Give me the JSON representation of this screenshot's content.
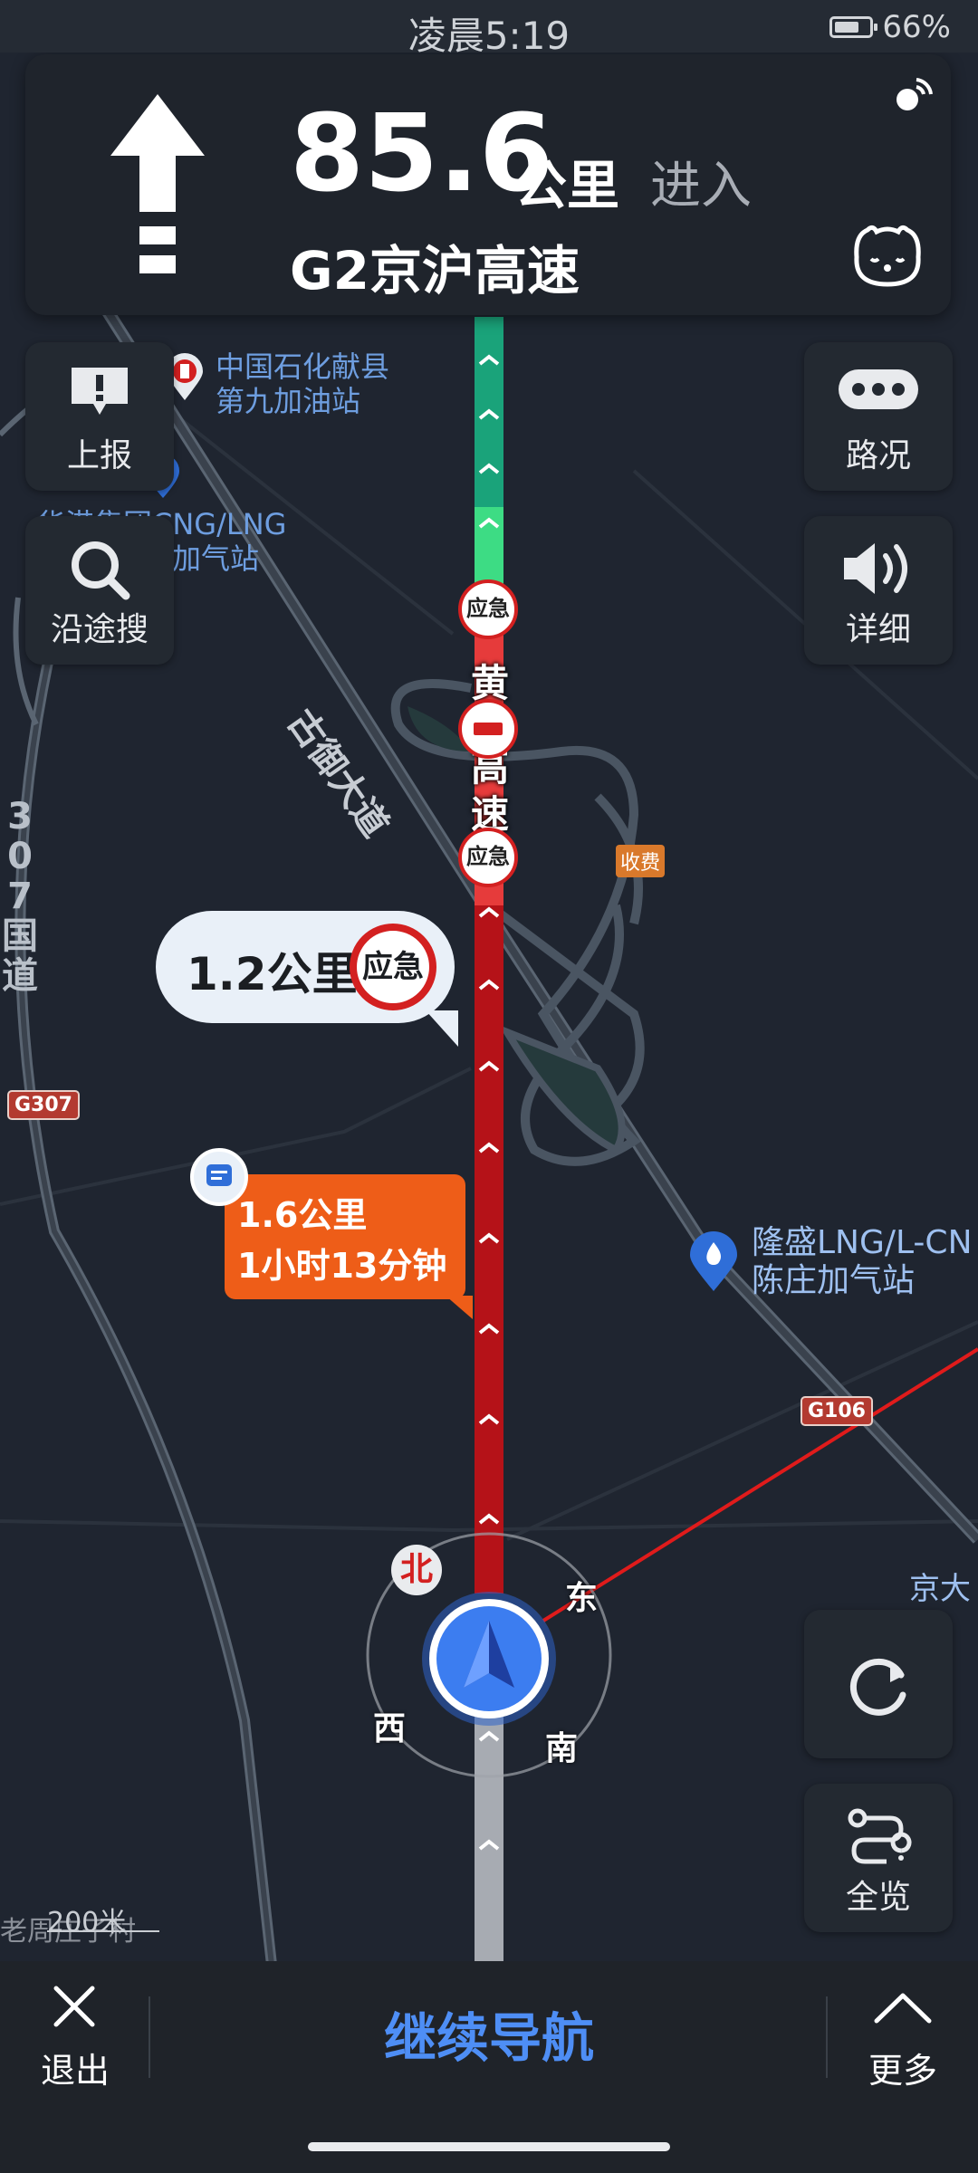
{
  "status": {
    "time": "凌晨5:19",
    "battery": "66%"
  },
  "nav": {
    "distance_value": "85.6",
    "distance_unit": "公里",
    "action": "进入",
    "road": "G2京沪高速"
  },
  "side_buttons": {
    "report": "上报",
    "along_search": "沿途搜",
    "traffic": "路况",
    "detail": "详细",
    "refresh": "",
    "overview": "全览"
  },
  "map": {
    "poi_sinopec": [
      "中国石化献县",
      "第九加油站"
    ],
    "poi_cng": [
      "华港集团CNG/LNG",
      "加气站"
    ],
    "poi_longsheng": [
      "隆盛LNG/L-CN",
      "陈庄加气站"
    ],
    "road_guyu": "古御大道",
    "road_307": [
      "3",
      "0",
      "7",
      "国",
      "道"
    ],
    "highway_vertical": [
      "黄",
      "高",
      "速"
    ],
    "shield_g307": "G307",
    "shield_g106": "G106",
    "toll": "收费",
    "emergency": "应急",
    "jingda": "京大",
    "laozhou": "老周庄子村",
    "scale": "200米"
  },
  "bubbles": {
    "emergency_distance": "1.2公里",
    "emergency_label": "应急",
    "congestion_distance": "1.6公里",
    "congestion_time": "1小时13分钟"
  },
  "compass": {
    "north": "北",
    "east": "东",
    "south": "南",
    "west": "西"
  },
  "bottom": {
    "exit": "退出",
    "continue": "继续导航",
    "more": "更多"
  },
  "colors": {
    "route_green": "#1aa37a",
    "route_red": "#b51218",
    "accent_blue": "#4e8ef5",
    "orange": "#ee5d18"
  }
}
